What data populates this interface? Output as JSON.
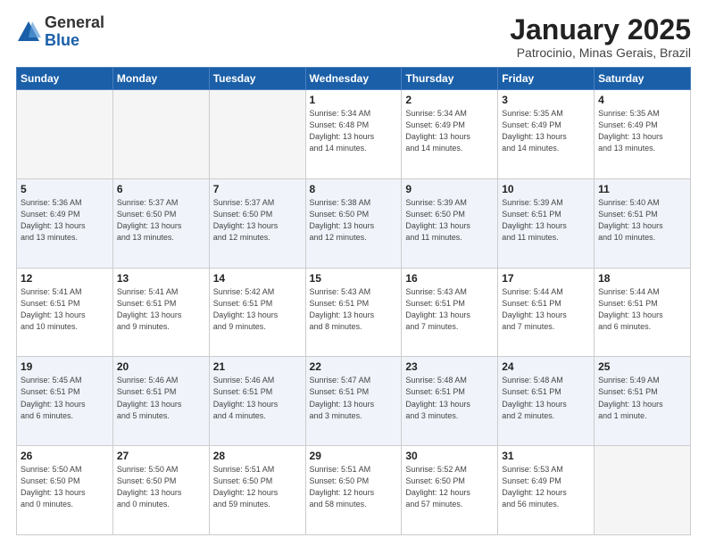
{
  "logo": {
    "general": "General",
    "blue": "Blue"
  },
  "title": "January 2025",
  "location": "Patrocinio, Minas Gerais, Brazil",
  "days_header": [
    "Sunday",
    "Monday",
    "Tuesday",
    "Wednesday",
    "Thursday",
    "Friday",
    "Saturday"
  ],
  "weeks": [
    [
      {
        "num": "",
        "info": ""
      },
      {
        "num": "",
        "info": ""
      },
      {
        "num": "",
        "info": ""
      },
      {
        "num": "1",
        "info": "Sunrise: 5:34 AM\nSunset: 6:48 PM\nDaylight: 13 hours\nand 14 minutes."
      },
      {
        "num": "2",
        "info": "Sunrise: 5:34 AM\nSunset: 6:49 PM\nDaylight: 13 hours\nand 14 minutes."
      },
      {
        "num": "3",
        "info": "Sunrise: 5:35 AM\nSunset: 6:49 PM\nDaylight: 13 hours\nand 14 minutes."
      },
      {
        "num": "4",
        "info": "Sunrise: 5:35 AM\nSunset: 6:49 PM\nDaylight: 13 hours\nand 13 minutes."
      }
    ],
    [
      {
        "num": "5",
        "info": "Sunrise: 5:36 AM\nSunset: 6:49 PM\nDaylight: 13 hours\nand 13 minutes."
      },
      {
        "num": "6",
        "info": "Sunrise: 5:37 AM\nSunset: 6:50 PM\nDaylight: 13 hours\nand 13 minutes."
      },
      {
        "num": "7",
        "info": "Sunrise: 5:37 AM\nSunset: 6:50 PM\nDaylight: 13 hours\nand 12 minutes."
      },
      {
        "num": "8",
        "info": "Sunrise: 5:38 AM\nSunset: 6:50 PM\nDaylight: 13 hours\nand 12 minutes."
      },
      {
        "num": "9",
        "info": "Sunrise: 5:39 AM\nSunset: 6:50 PM\nDaylight: 13 hours\nand 11 minutes."
      },
      {
        "num": "10",
        "info": "Sunrise: 5:39 AM\nSunset: 6:51 PM\nDaylight: 13 hours\nand 11 minutes."
      },
      {
        "num": "11",
        "info": "Sunrise: 5:40 AM\nSunset: 6:51 PM\nDaylight: 13 hours\nand 10 minutes."
      }
    ],
    [
      {
        "num": "12",
        "info": "Sunrise: 5:41 AM\nSunset: 6:51 PM\nDaylight: 13 hours\nand 10 minutes."
      },
      {
        "num": "13",
        "info": "Sunrise: 5:41 AM\nSunset: 6:51 PM\nDaylight: 13 hours\nand 9 minutes."
      },
      {
        "num": "14",
        "info": "Sunrise: 5:42 AM\nSunset: 6:51 PM\nDaylight: 13 hours\nand 9 minutes."
      },
      {
        "num": "15",
        "info": "Sunrise: 5:43 AM\nSunset: 6:51 PM\nDaylight: 13 hours\nand 8 minutes."
      },
      {
        "num": "16",
        "info": "Sunrise: 5:43 AM\nSunset: 6:51 PM\nDaylight: 13 hours\nand 7 minutes."
      },
      {
        "num": "17",
        "info": "Sunrise: 5:44 AM\nSunset: 6:51 PM\nDaylight: 13 hours\nand 7 minutes."
      },
      {
        "num": "18",
        "info": "Sunrise: 5:44 AM\nSunset: 6:51 PM\nDaylight: 13 hours\nand 6 minutes."
      }
    ],
    [
      {
        "num": "19",
        "info": "Sunrise: 5:45 AM\nSunset: 6:51 PM\nDaylight: 13 hours\nand 6 minutes."
      },
      {
        "num": "20",
        "info": "Sunrise: 5:46 AM\nSunset: 6:51 PM\nDaylight: 13 hours\nand 5 minutes."
      },
      {
        "num": "21",
        "info": "Sunrise: 5:46 AM\nSunset: 6:51 PM\nDaylight: 13 hours\nand 4 minutes."
      },
      {
        "num": "22",
        "info": "Sunrise: 5:47 AM\nSunset: 6:51 PM\nDaylight: 13 hours\nand 3 minutes."
      },
      {
        "num": "23",
        "info": "Sunrise: 5:48 AM\nSunset: 6:51 PM\nDaylight: 13 hours\nand 3 minutes."
      },
      {
        "num": "24",
        "info": "Sunrise: 5:48 AM\nSunset: 6:51 PM\nDaylight: 13 hours\nand 2 minutes."
      },
      {
        "num": "25",
        "info": "Sunrise: 5:49 AM\nSunset: 6:51 PM\nDaylight: 13 hours\nand 1 minute."
      }
    ],
    [
      {
        "num": "26",
        "info": "Sunrise: 5:50 AM\nSunset: 6:50 PM\nDaylight: 13 hours\nand 0 minutes."
      },
      {
        "num": "27",
        "info": "Sunrise: 5:50 AM\nSunset: 6:50 PM\nDaylight: 13 hours\nand 0 minutes."
      },
      {
        "num": "28",
        "info": "Sunrise: 5:51 AM\nSunset: 6:50 PM\nDaylight: 12 hours\nand 59 minutes."
      },
      {
        "num": "29",
        "info": "Sunrise: 5:51 AM\nSunset: 6:50 PM\nDaylight: 12 hours\nand 58 minutes."
      },
      {
        "num": "30",
        "info": "Sunrise: 5:52 AM\nSunset: 6:50 PM\nDaylight: 12 hours\nand 57 minutes."
      },
      {
        "num": "31",
        "info": "Sunrise: 5:53 AM\nSunset: 6:49 PM\nDaylight: 12 hours\nand 56 minutes."
      },
      {
        "num": "",
        "info": ""
      }
    ]
  ]
}
